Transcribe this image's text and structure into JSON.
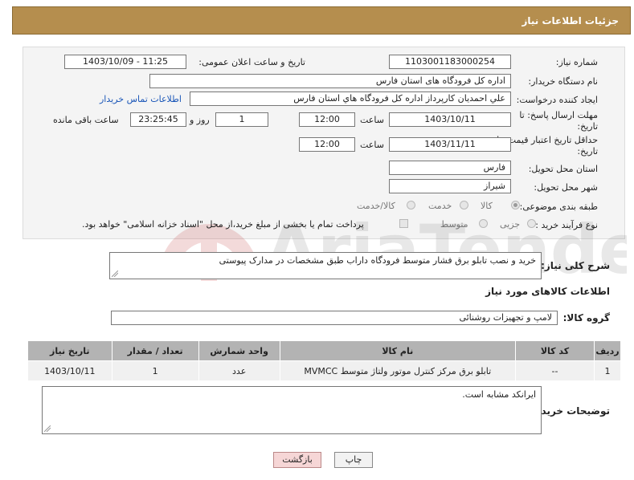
{
  "header": {
    "title": "جزئیات اطلاعات نیاز"
  },
  "fields": {
    "need_number_label": "شماره نیاز:",
    "need_number": "1103001183000254",
    "announce_label": "تاریخ و ساعت اعلان عمومی:",
    "announce_value": "1403/10/09 - 11:25",
    "buyer_org_label": "نام دستگاه خریدار:",
    "buyer_org": "اداره کل فرودگاه های استان فارس",
    "creator_label": "ایجاد کننده درخواست:",
    "creator": "علي  احمديان كارپرداز اداره كل فرودگاه هاي استان فارس",
    "contact_link": "اطلاعات تماس خریدار",
    "deadline_label_1": "مهلت ارسال پاسخ: تا",
    "deadline_label_2": "تاریخ:",
    "deadline_date": "1403/10/11",
    "time_label": "ساعت",
    "deadline_time": "12:00",
    "days_value": "1",
    "days_label": "روز و",
    "remaining_time": "23:25:45",
    "remaining_label": "ساعت باقی مانده",
    "price_label_1": "حداقل تاریخ اعتبار قیمت: تا",
    "price_label_2": "تاریخ:",
    "price_date": "1403/11/11",
    "price_time": "12:00",
    "province_label": "استان محل تحویل:",
    "province": "فارس",
    "city_label": "شهر محل تحویل:",
    "city": "شیراز",
    "category_label": "طبقه بندی موضوعی:",
    "category_options": [
      "کالا",
      "خدمت",
      "کالا/خدمت"
    ],
    "process_label": "نوع فرآیند خرید :",
    "process_options": [
      "جزیی",
      "متوسط"
    ],
    "payment_note": "پرداخت تمام یا بخشی از مبلغ خرید،از محل \"اسناد خزانه اسلامی\" خواهد بود."
  },
  "description": {
    "label": "شرح کلی نیاز:",
    "text": "خرید و نصب تابلو برق فشار متوسط فرودگاه داراب طبق مشخصات در مدارک پیوستی"
  },
  "goods": {
    "section_title": "اطلاعات کالاهای مورد نیاز",
    "group_label": "گروه کالا:",
    "group_value": "لامپ و تجهیزات روشنائی"
  },
  "table": {
    "headers": [
      "ردیف",
      "کد کالا",
      "نام کالا",
      "واحد شمارش",
      "تعداد / مقدار",
      "تاریخ نیاز"
    ],
    "rows": [
      [
        "1",
        "--",
        "تابلو برق مرکز کنترل موتور ولتاژ متوسط MVMCC",
        "عدد",
        "1",
        "1403/10/11"
      ]
    ]
  },
  "buyer_notes": {
    "label": "توضیحات خریدار:",
    "text": "ایرانکد مشابه است."
  },
  "buttons": {
    "print": "چاپ",
    "back": "بازگشت"
  },
  "watermark": {
    "text": "AriaTender.neT"
  },
  "colors": {
    "header": "#b58e4e",
    "link": "#1a56b8",
    "back_button": "#f6d6d6"
  }
}
